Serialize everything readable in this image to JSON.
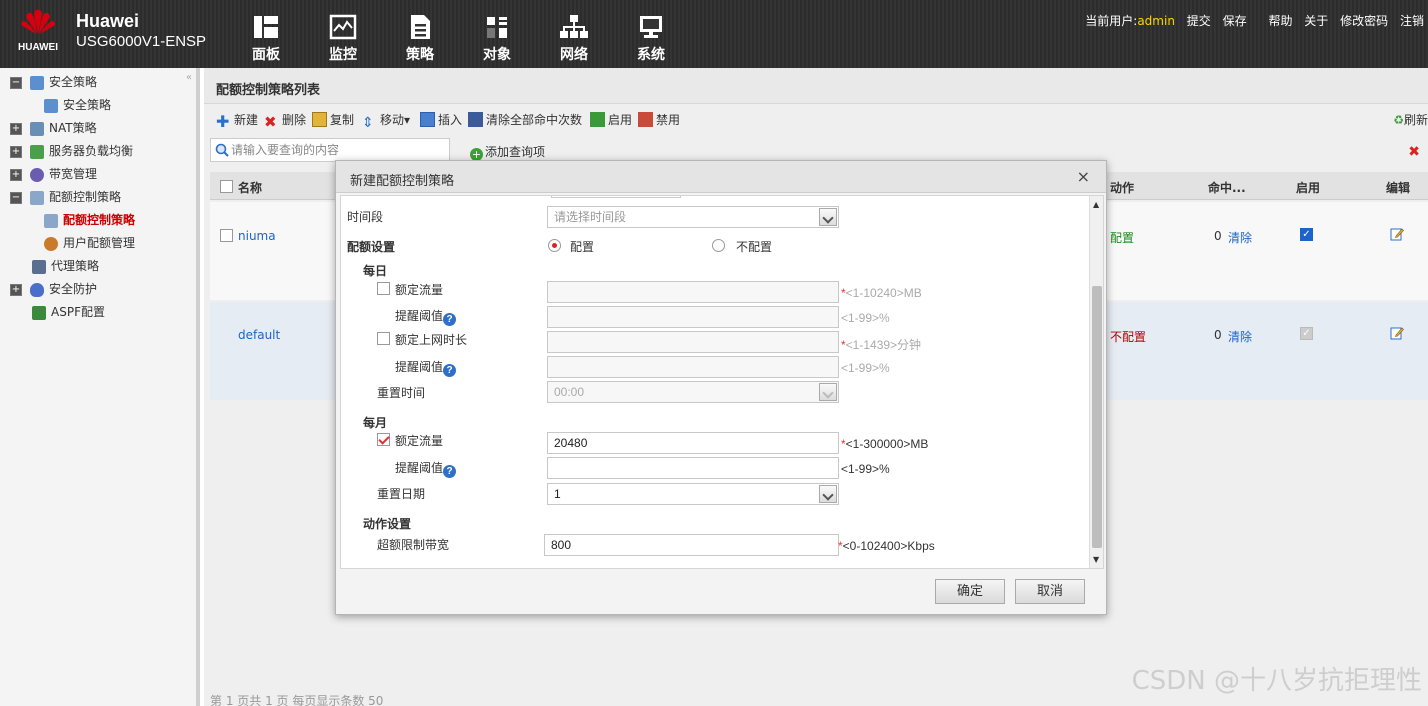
{
  "header": {
    "logo_text": "HUAWEI",
    "brand": "Huawei",
    "model": "USG6000V1-ENSP",
    "nav": [
      {
        "label": "面板",
        "icon": "dashboard-icon"
      },
      {
        "label": "监控",
        "icon": "monitor-icon"
      },
      {
        "label": "策略",
        "icon": "policy-icon"
      },
      {
        "label": "对象",
        "icon": "object-icon"
      },
      {
        "label": "网络",
        "icon": "network-icon"
      },
      {
        "label": "系统",
        "icon": "system-icon"
      }
    ],
    "current_user_label": "当前用户:",
    "current_user": "admin",
    "links": [
      "提交",
      "保存",
      "帮助",
      "关于",
      "修改密码",
      "注销"
    ]
  },
  "sidebar": {
    "items": [
      {
        "label": "安全策略",
        "level": 0,
        "expander": "−"
      },
      {
        "label": "安全策略",
        "level": 1
      },
      {
        "label": "NAT策略",
        "level": 0,
        "expander": "+"
      },
      {
        "label": "服务器负载均衡",
        "level": 0,
        "expander": "+"
      },
      {
        "label": "带宽管理",
        "level": 0,
        "expander": "+"
      },
      {
        "label": "配额控制策略",
        "level": 0,
        "expander": "−"
      },
      {
        "label": "配额控制策略",
        "level": 1,
        "active": true
      },
      {
        "label": "用户配额管理",
        "level": 1
      },
      {
        "label": "代理策略",
        "level": 0
      },
      {
        "label": "安全防护",
        "level": 0,
        "expander": "+"
      },
      {
        "label": "ASPF配置",
        "level": 0
      }
    ]
  },
  "main": {
    "title": "配额控制策略列表",
    "toolbar": {
      "new": "新建",
      "delete": "删除",
      "copy": "复制",
      "move": "移动▾",
      "insert": "插入",
      "clear_hits": "清除全部命中次数",
      "enable": "启用",
      "disable": "禁用",
      "refresh": "刷新"
    },
    "search_placeholder": "请输入要查询的内容",
    "add_query": "添加查询项",
    "columns": [
      "名称",
      "动作",
      "命中...",
      "启用",
      "编辑"
    ],
    "rows": [
      {
        "name": "niuma",
        "action": "配置",
        "hits": "0",
        "clear": "清除",
        "enabled": true
      },
      {
        "name": "default",
        "action": "不配置",
        "hits": "0",
        "clear": "清除",
        "enabled": true
      }
    ],
    "pager": "第 1 页共 1 页  每页显示条数 50"
  },
  "dialog": {
    "title": "新建配额控制策略",
    "close": "×",
    "time_range_label": "时间段",
    "time_range_placeholder": "请选择时间段",
    "quota_settings_label": "配额设置",
    "radio_config": "配置",
    "radio_no_config": "不配置",
    "daily_label": "每日",
    "daily_quota_label": "额定流量",
    "daily_quota_hint": "<1-10240>MB",
    "daily_alert_label": "提醒阈值",
    "daily_alert_hint": "<1-99>%",
    "daily_online_label": "额定上网时长",
    "daily_online_hint": "<1-1439>分钟",
    "daily_online_alert_label": "提醒阈值",
    "daily_online_alert_hint": "<1-99>%",
    "reset_time_label": "重置时间",
    "reset_time_value": "00:00",
    "monthly_label": "每月",
    "monthly_quota_label": "额定流量",
    "monthly_quota_value": "20480",
    "monthly_quota_hint": "<1-300000>MB",
    "monthly_alert_label": "提醒阈值",
    "monthly_alert_hint": "<1-99>%",
    "reset_date_label": "重置日期",
    "reset_date_value": "1",
    "action_settings_label": "动作设置",
    "overquota_bw_label": "超额限制带宽",
    "overquota_bw_value": "800",
    "overquota_bw_hint": "<0-102400>Kbps",
    "ok": "确定",
    "cancel": "取消"
  },
  "watermark": "CSDN @十八岁抗拒理性",
  "colors": {
    "accent_red": "#d22222",
    "user_yellow": "#ffd400",
    "link_blue": "#1e63c7"
  }
}
